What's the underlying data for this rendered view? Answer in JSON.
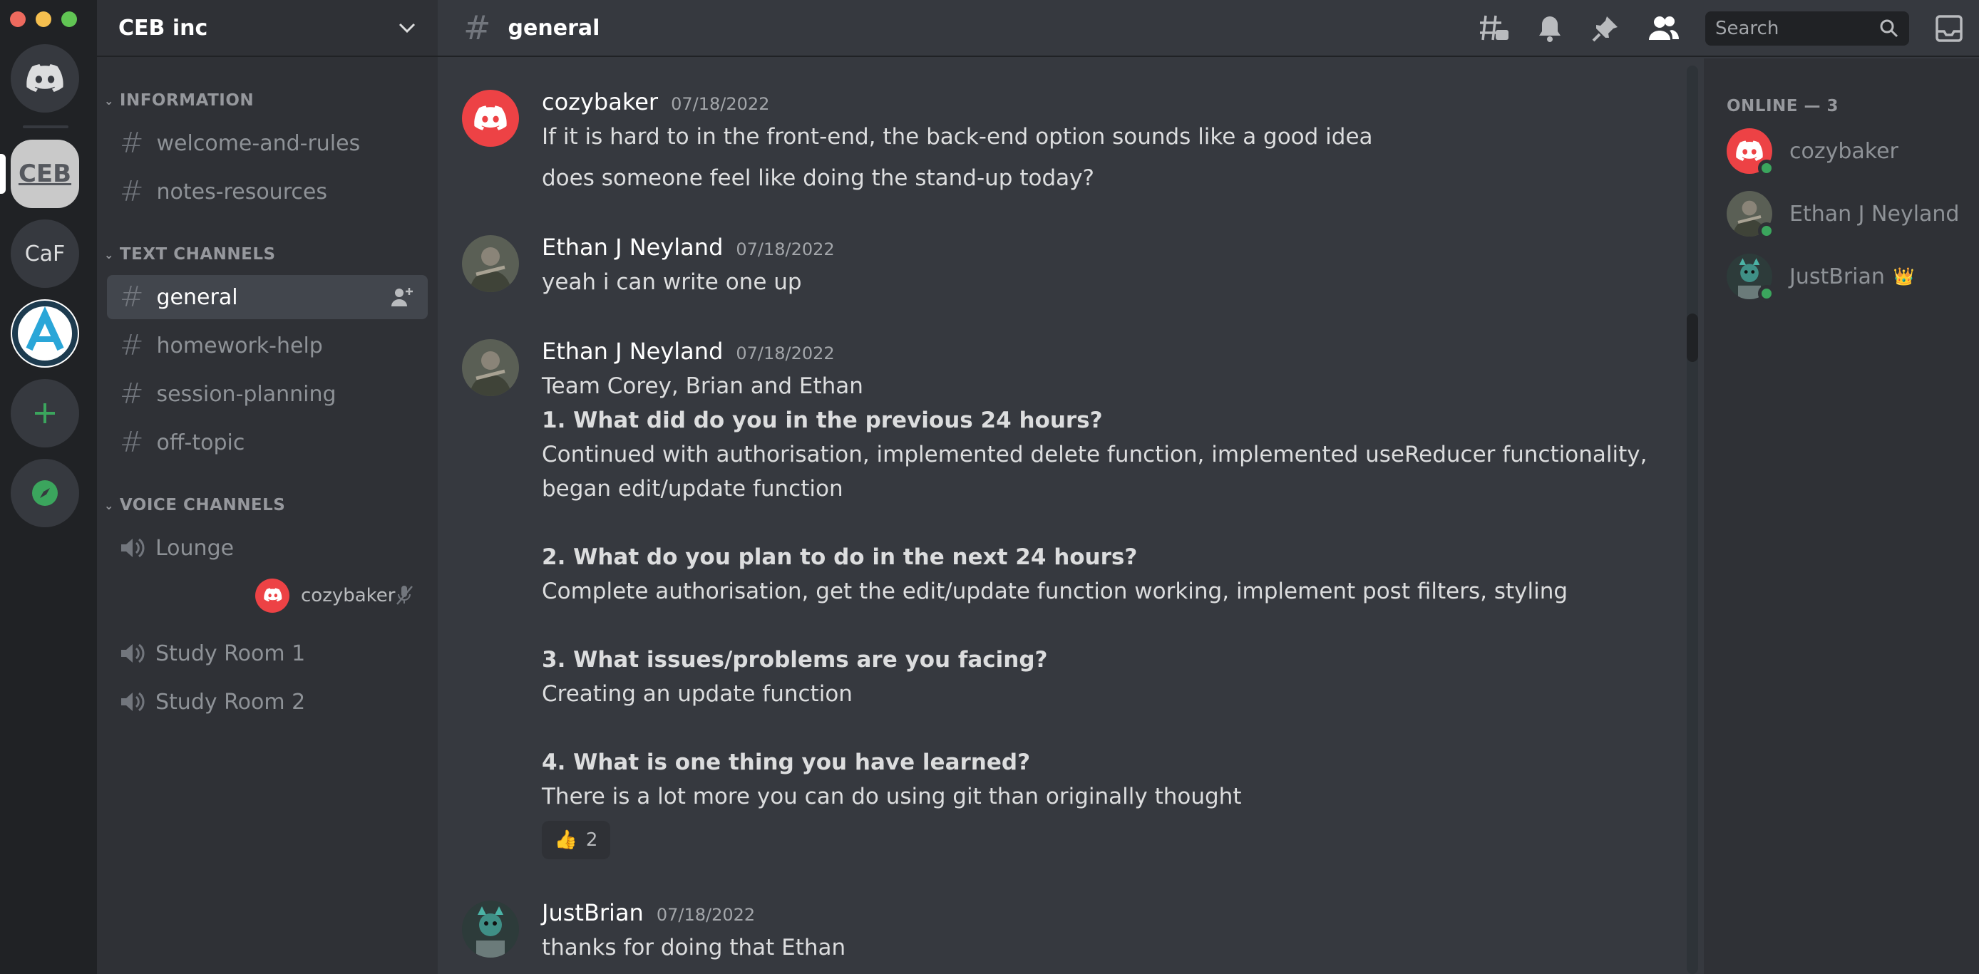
{
  "app": {
    "traffic_colors": [
      "#ed6a5e",
      "#f5bf4f",
      "#61c554"
    ]
  },
  "servers": {
    "ceb_label": "CEB",
    "caf_label": "CaF"
  },
  "guild": {
    "name": "CEB inc"
  },
  "categories": {
    "information": "INFORMATION",
    "text": "TEXT CHANNELS",
    "voice": "VOICE CHANNELS"
  },
  "channels": {
    "info": [
      "welcome-and-rules",
      "notes-resources"
    ],
    "text": [
      "general",
      "homework-help",
      "session-planning",
      "off-topic"
    ],
    "voice": [
      "Lounge",
      "Study Room 1",
      "Study Room 2"
    ],
    "voice_user": "cozybaker"
  },
  "header": {
    "channel": "general",
    "search_placeholder": "Search"
  },
  "messages": [
    {
      "author": "cozybaker",
      "timestamp": "07/18/2022",
      "lines": [
        "If it is hard to in the front-end, the back-end option sounds like a good idea",
        "does someone feel like doing the stand-up today?"
      ]
    },
    {
      "author": "Ethan J Neyland",
      "timestamp": "07/18/2022",
      "lines": [
        "yeah i can write one up"
      ]
    },
    {
      "author": "Ethan J Neyland",
      "timestamp": "07/18/2022",
      "lines": [
        "Team Corey, Brian and Ethan",
        "1. What did do you in the previous 24 hours?",
        "Continued with authorisation, implemented delete function, implemented useReducer functionality,",
        "began edit/update function",
        "2. What do you plan to do in the next 24 hours?",
        "Complete authorisation, get the edit/update function working, implement post filters, styling",
        "3. What issues/problems are you facing?",
        "Creating an update function",
        "4. What is one thing you have learned?",
        "There is a lot more you can do using git than originally thought"
      ],
      "reaction": {
        "emoji": "👍",
        "count": "2"
      }
    },
    {
      "author": "JustBrian",
      "timestamp": "07/18/2022",
      "lines": [
        "thanks for doing that Ethan"
      ]
    }
  ],
  "members": {
    "title": "ONLINE — 3",
    "list": [
      "cozybaker",
      "Ethan J Neyland",
      "JustBrian"
    ],
    "owner_badge": "👑"
  },
  "colors": {
    "discord_red": "#ed4245",
    "online": "#3ba55d",
    "crown": "#faa61a"
  }
}
